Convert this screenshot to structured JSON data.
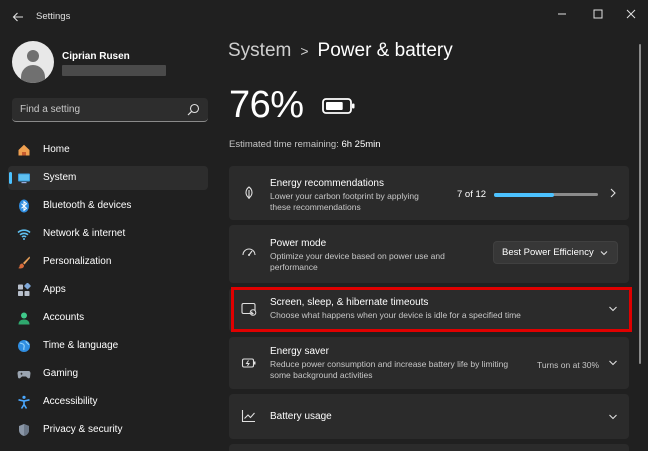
{
  "app": {
    "title": "Settings",
    "window_controls": [
      "minimize",
      "maximize",
      "close"
    ]
  },
  "profile": {
    "name": "Ciprian Rusen"
  },
  "search": {
    "placeholder": "Find a setting"
  },
  "sidebar": {
    "items": [
      {
        "label": "Home",
        "icon": "home-icon",
        "selected": false
      },
      {
        "label": "System",
        "icon": "system-icon",
        "selected": true
      },
      {
        "label": "Bluetooth & devices",
        "icon": "bluetooth-icon",
        "selected": false
      },
      {
        "label": "Network & internet",
        "icon": "wifi-icon",
        "selected": false
      },
      {
        "label": "Personalization",
        "icon": "brush-icon",
        "selected": false
      },
      {
        "label": "Apps",
        "icon": "apps-icon",
        "selected": false
      },
      {
        "label": "Accounts",
        "icon": "accounts-icon",
        "selected": false
      },
      {
        "label": "Time & language",
        "icon": "globe-icon",
        "selected": false
      },
      {
        "label": "Gaming",
        "icon": "gaming-icon",
        "selected": false
      },
      {
        "label": "Accessibility",
        "icon": "accessibility-icon",
        "selected": false
      },
      {
        "label": "Privacy & security",
        "icon": "shield-icon",
        "selected": false
      }
    ]
  },
  "breadcrumb": {
    "parent": "System",
    "separator": ">",
    "current": "Power & battery"
  },
  "battery": {
    "percent_text": "76%",
    "level": 0.76,
    "estimate_label": "Estimated time remaining:",
    "estimate_value": "6h 25min"
  },
  "cards": {
    "energy_recommendations": {
      "title": "Energy recommendations",
      "desc_line1": "Lower your carbon footprint by applying",
      "desc_line2": "these recommendations",
      "count": "7 of 12",
      "progress": 0.58
    },
    "power_mode": {
      "title": "Power mode",
      "desc_line1": "Optimize your device based on power use and",
      "desc_line2": "performance",
      "selected": "Best Power Efficiency"
    },
    "screen_sleep": {
      "title": "Screen, sleep, & hibernate timeouts",
      "desc_line1": "Choose what happens when your device is idle for a specified time"
    },
    "energy_saver": {
      "title": "Energy saver",
      "desc_line1": "Reduce power consumption and increase battery life by limiting",
      "desc_line2": "some background activities",
      "status": "Turns on at 30%"
    },
    "battery_usage": {
      "title": "Battery usage"
    }
  },
  "colors": {
    "background": "#202020",
    "card": "#2b2b2b",
    "accent": "#4cc2ff",
    "highlight": "#e00000"
  }
}
